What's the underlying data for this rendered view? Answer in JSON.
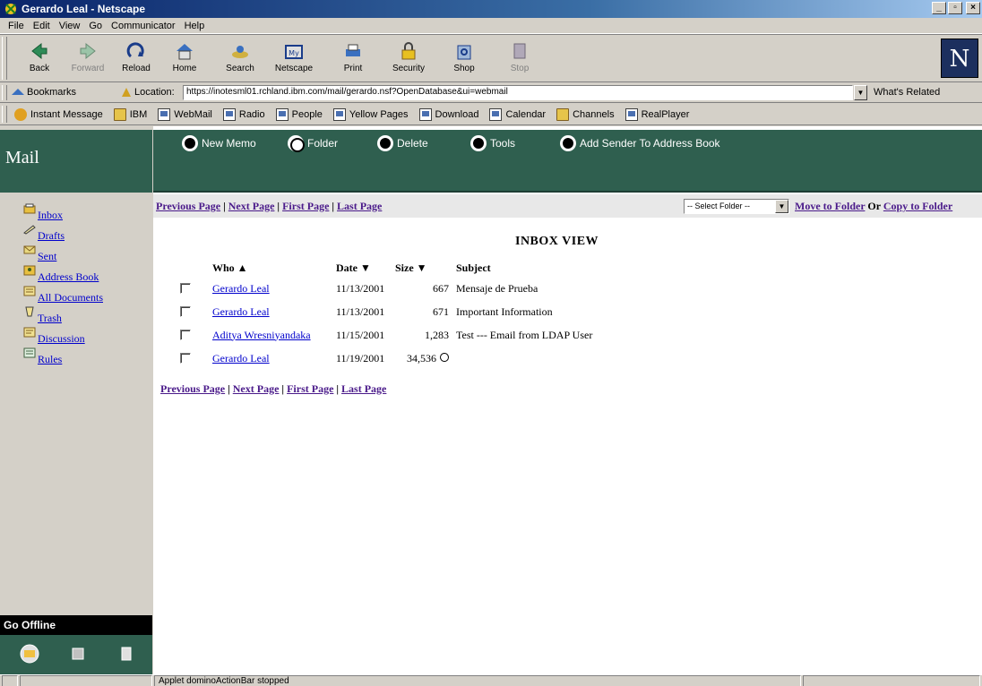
{
  "window": {
    "title": "Gerardo Leal - Netscape",
    "controls": [
      "_",
      "▫",
      "×"
    ]
  },
  "menubar": [
    "File",
    "Edit",
    "View",
    "Go",
    "Communicator",
    "Help"
  ],
  "navbar": {
    "buttons": [
      {
        "label": "Back"
      },
      {
        "label": "Forward"
      },
      {
        "label": "Reload"
      },
      {
        "label": "Home"
      },
      {
        "label": "Search"
      },
      {
        "label": "Netscape"
      },
      {
        "label": "Print"
      },
      {
        "label": "Security"
      },
      {
        "label": "Shop"
      },
      {
        "label": "Stop"
      }
    ],
    "logo": "N"
  },
  "location": {
    "bookmarks": "Bookmarks",
    "label": "Location:",
    "url": "https://inotesml01.rchland.ibm.com/mail/gerardo.nsf?OpenDatabase&ui=webmail",
    "related": "What's Related"
  },
  "personal_toolbar": [
    {
      "label": "Instant Message"
    },
    {
      "label": "IBM"
    },
    {
      "label": "WebMail"
    },
    {
      "label": "Radio"
    },
    {
      "label": "People"
    },
    {
      "label": "Yellow Pages"
    },
    {
      "label": "Download"
    },
    {
      "label": "Calendar"
    },
    {
      "label": "Channels"
    },
    {
      "label": "RealPlayer"
    }
  ],
  "left": {
    "title": "Mail",
    "folders": [
      "Inbox",
      "Drafts",
      "Sent",
      "Address Book",
      "All Documents",
      "Trash",
      "Discussion",
      "Rules"
    ],
    "offline": "Go Offline"
  },
  "actions": {
    "new_memo": "New Memo",
    "folder": "Folder",
    "delete": "Delete",
    "tools": "Tools",
    "add_sender": "Add Sender To Address Book"
  },
  "pager": {
    "prev": "Previous Page",
    "next": "Next Page",
    "first": "First Page",
    "last": "Last Page",
    "sep": " | "
  },
  "folder_ops": {
    "select_placeholder": "-- Select Folder --",
    "move": "Move to Folder",
    "or": "Or",
    "copy": "Copy to Folder"
  },
  "view": {
    "title": "INBOX VIEW",
    "columns": {
      "who": "Who ▲",
      "date": "Date ▼",
      "size": "Size ▼",
      "subject": "Subject"
    },
    "rows": [
      {
        "who": "Gerardo Leal",
        "date": "11/13/2001",
        "size": "667",
        "subject": "Mensaje de Prueba",
        "attachment": false
      },
      {
        "who": "Gerardo Leal",
        "date": "11/13/2001",
        "size": "671",
        "subject": "Important Information",
        "attachment": false
      },
      {
        "who": "Aditya Wresniyandaka",
        "date": "11/15/2001",
        "size": "1,283",
        "subject": "Test --- Email from LDAP User",
        "attachment": false
      },
      {
        "who": "Gerardo Leal",
        "date": "11/19/2001",
        "size": "34,536",
        "subject": "",
        "attachment": true
      }
    ]
  },
  "status": {
    "message": "Applet dominoActionBar stopped"
  }
}
